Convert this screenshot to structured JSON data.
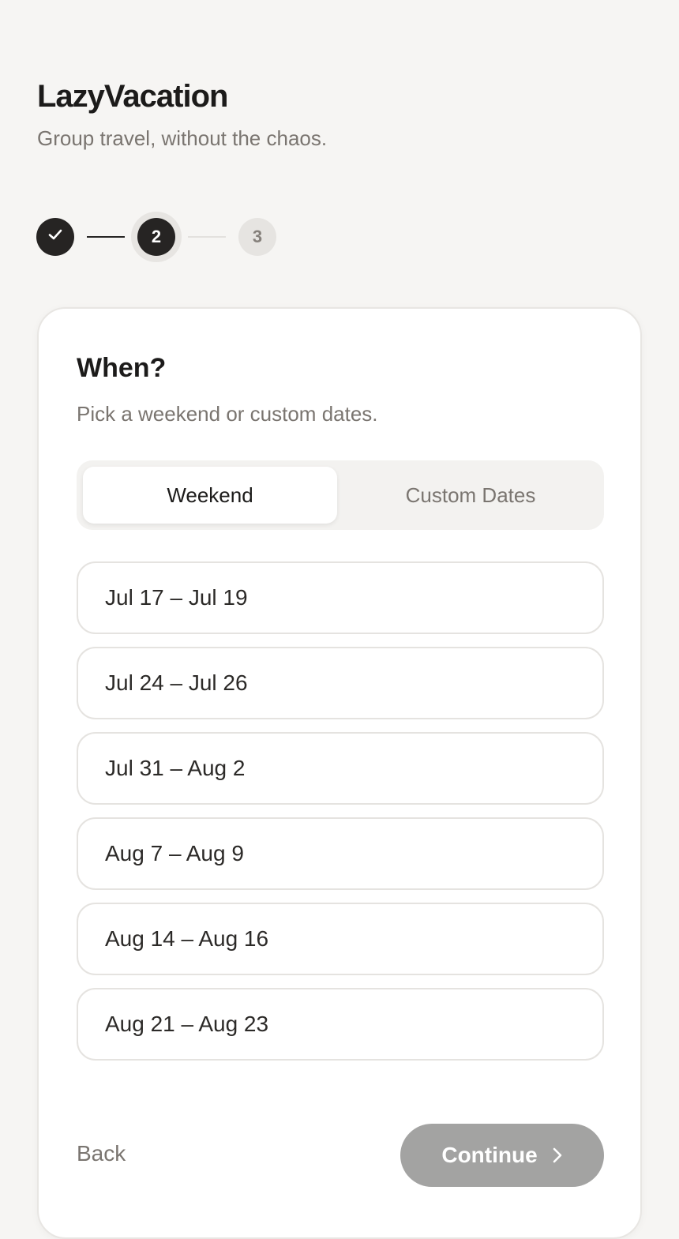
{
  "app": {
    "title": "LazyVacation",
    "tagline": "Group travel, without the chaos."
  },
  "stepper": {
    "steps": [
      {
        "label": "",
        "state": "completed",
        "icon": "check-icon"
      },
      {
        "label": "2",
        "state": "current"
      },
      {
        "label": "3",
        "state": "upcoming"
      }
    ]
  },
  "card": {
    "title": "When?",
    "subtitle": "Pick a weekend or custom dates.",
    "tabs": [
      {
        "label": "Weekend",
        "selected": true
      },
      {
        "label": "Custom Dates",
        "selected": false
      }
    ],
    "date_options": [
      "Jul 17 – Jul 19",
      "Jul 24 – Jul 26",
      "Jul 31 – Aug 2",
      "Aug 7 – Aug 9",
      "Aug 14 – Aug 16",
      "Aug 21 – Aug 23"
    ],
    "back_label": "Back",
    "continue_label": "Continue",
    "continue_icon": "chevron-right-icon"
  },
  "colors": {
    "background": "#f6f5f3",
    "primary_dark": "#262423",
    "muted_text": "#7a7570",
    "continue_disabled": "#a3a3a2"
  }
}
